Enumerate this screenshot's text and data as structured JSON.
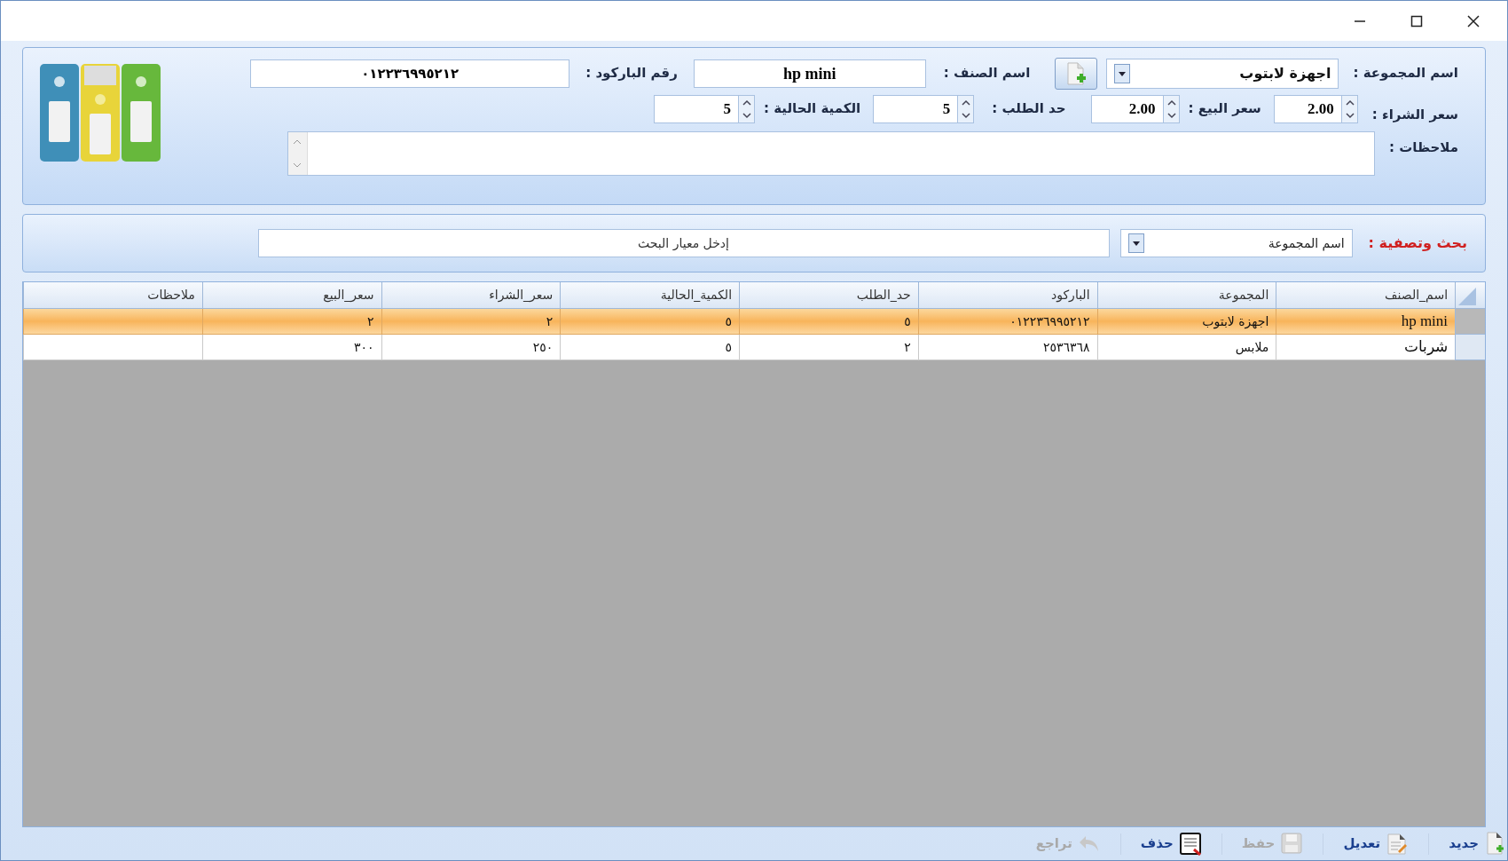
{
  "form": {
    "group": {
      "label": "اسم المجموعة :",
      "value": "اجهزة لابتوب"
    },
    "item_name": {
      "label": "اسم الصنف :",
      "value": "hp mini"
    },
    "barcode": {
      "label": "رقم الباركود :",
      "value": "٠١٢٢٣٦٩٩٥٢١٢"
    },
    "buy_price": {
      "label": "سعر الشراء :",
      "value": "2.00"
    },
    "sell_price": {
      "label": "سعر البيع :",
      "value": "2.00"
    },
    "order_limit": {
      "label": "حد الطلب :",
      "value": "5"
    },
    "current_qty": {
      "label": "الكمية الحالية :",
      "value": "5"
    },
    "notes": {
      "label": "ملاحظات :"
    }
  },
  "search": {
    "label": "بحث وتصفية :",
    "field": "اسم المجموعة",
    "placeholder": "إدخل معيار البحث"
  },
  "table": {
    "columns": [
      "اسم_الصنف",
      "المجموعة",
      "الباركود",
      "حد_الطلب",
      "الكمية_الحالية",
      "سعر_الشراء",
      "سعر_البيع",
      "ملاحظات"
    ],
    "rows": [
      {
        "selected": true,
        "cells": [
          "hp mini",
          "اجهزة لابتوب",
          "٠١٢٢٣٦٩٩٥٢١٢",
          "٥",
          "٥",
          "٢",
          "٢",
          ""
        ]
      },
      {
        "selected": false,
        "cells": [
          "شربات",
          "ملابس",
          "٢٥٣٦٣٦٨",
          "٢",
          "٥",
          "٢٥٠",
          "٣٠٠",
          ""
        ]
      }
    ]
  },
  "toolbar": [
    {
      "kind": "new",
      "label": "جديد",
      "disabled": false
    },
    {
      "kind": "edit",
      "label": "تعديل",
      "disabled": false
    },
    {
      "kind": "save",
      "label": "حفظ",
      "disabled": true
    },
    {
      "kind": "delete",
      "label": "حذف",
      "disabled": false
    },
    {
      "kind": "undo",
      "label": "تراجع",
      "disabled": true
    }
  ]
}
